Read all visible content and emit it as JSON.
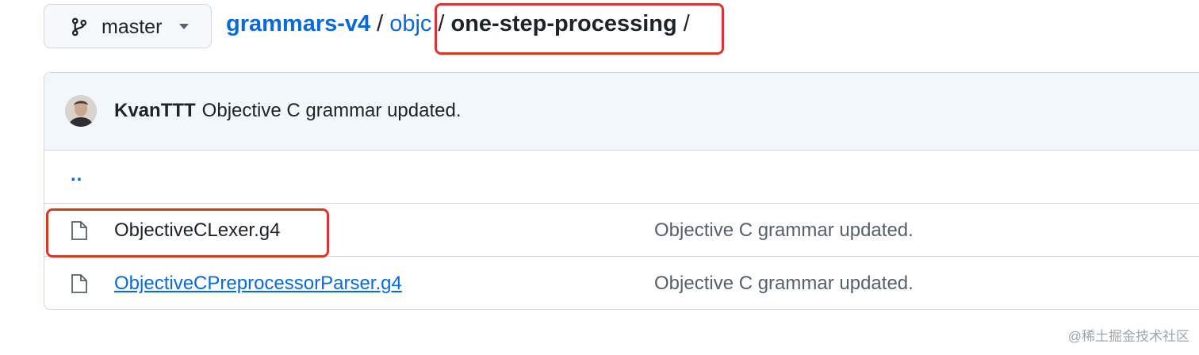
{
  "branch": {
    "label": "master",
    "icon": "git-branch-icon"
  },
  "breadcrumb": {
    "repo": "grammars-v4",
    "separator": "/",
    "dir": "objc",
    "current": "one-step-processing",
    "trailing": "/"
  },
  "commit": {
    "author": "KvanTTT",
    "message": "Objective C grammar updated."
  },
  "files": {
    "up_label": "..",
    "items": [
      {
        "name": "ObjectiveCLexer.g4",
        "message": "Objective C grammar updated.",
        "icon": "file-icon"
      },
      {
        "name": "ObjectiveCPreprocessorParser.g4",
        "message": "Objective C grammar updated.",
        "icon": "file-icon"
      }
    ]
  },
  "annotation_color": "#d9372b",
  "watermark": "@稀土掘金技术社区"
}
